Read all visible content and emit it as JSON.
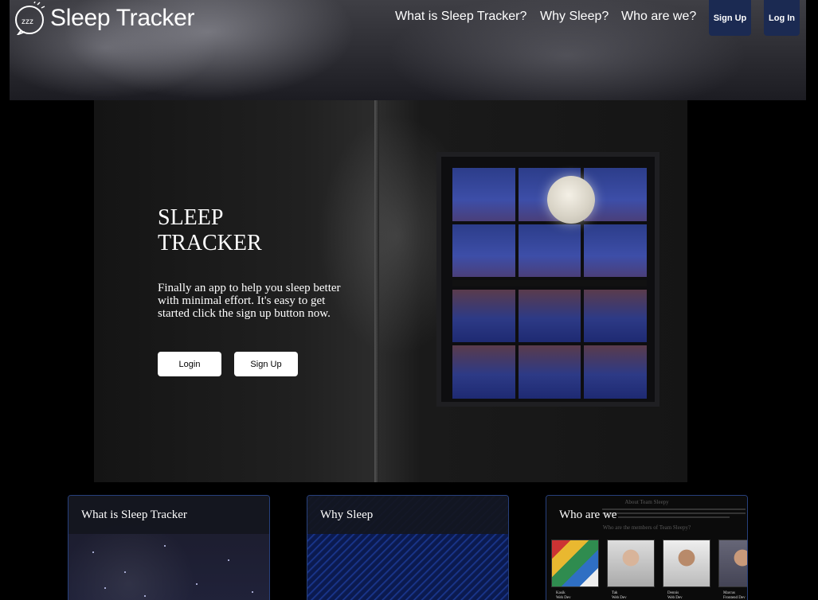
{
  "header": {
    "brand": "Sleep Tracker",
    "nav": [
      {
        "label": "What is Sleep Tracker?"
      },
      {
        "label": "Why Sleep?"
      },
      {
        "label": "Who are we?"
      }
    ],
    "signup_label": "Sign Up",
    "login_label": "Log In"
  },
  "hero": {
    "title": "SLEEP TRACKER",
    "text": "Finally an app to help you sleep better with minimal effort. It's easy to get started click the sign up button now.",
    "login_button": "Login",
    "signup_button": "Sign Up"
  },
  "cards": [
    {
      "title": "What is Sleep Tracker"
    },
    {
      "title": "Why Sleep"
    },
    {
      "title": "Who are we",
      "doc_title": "About Team Sleepy",
      "doc_subtitle": "Who are the members of Team Sleepy?",
      "members": [
        {
          "name": "Kasik",
          "role": "Web Dev"
        },
        {
          "name": "Tak",
          "role": "Web Dev"
        },
        {
          "name": "Dennis",
          "role": "Web Dev"
        },
        {
          "name": "Marcus",
          "role": "Frontend Dev"
        }
      ]
    }
  ],
  "colors": {
    "nav_button_bg": "#1b2a52",
    "card_border": "#27407c",
    "page_bg": "#000000"
  }
}
